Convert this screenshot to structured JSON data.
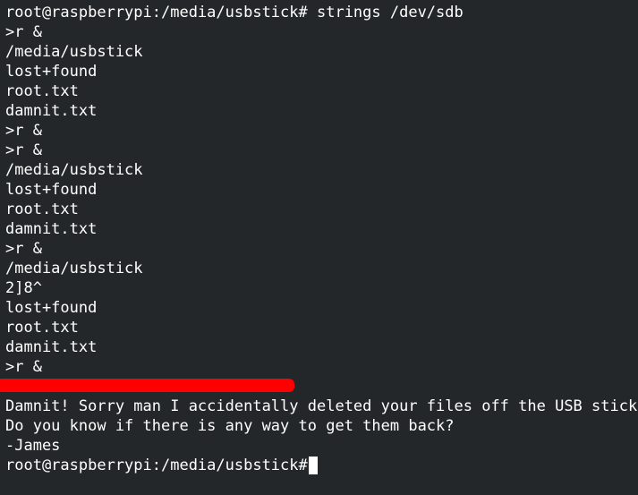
{
  "terminal": {
    "lines": [
      "root@raspberrypi:/media/usbstick# strings /dev/sdb",
      ">r &",
      "/media/usbstick",
      "lost+found",
      "root.txt",
      "damnit.txt",
      ">r &",
      ">r &",
      "/media/usbstick",
      "lost+found",
      "root.txt",
      "damnit.txt",
      ">r &",
      "/media/usbstick",
      "2]8^",
      "lost+found",
      "root.txt",
      "damnit.txt",
      ">r &"
    ],
    "message_lines": [
      "Damnit! Sorry man I accidentally deleted your files off the USB stick.",
      "Do you know if there is any way to get them back?",
      "-James"
    ],
    "prompt": "root@raspberrypi:/media/usbstick# ",
    "colors": {
      "background": "#232729",
      "text": "#ffffff",
      "redaction": "#ff0000"
    }
  }
}
